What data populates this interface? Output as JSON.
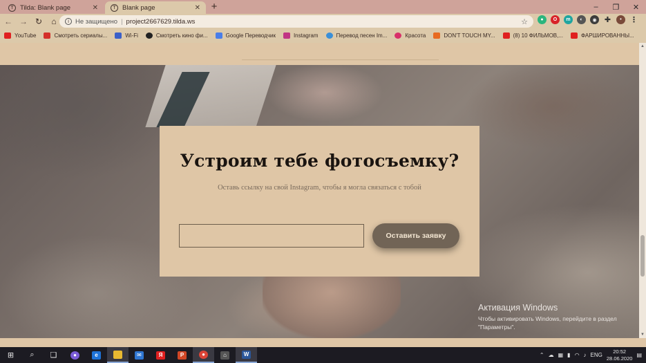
{
  "browser": {
    "tabs": [
      {
        "title": "Tilda: Blank page",
        "active": false
      },
      {
        "title": "Blank page",
        "active": true
      }
    ],
    "new_tab_symbol": "+",
    "window_controls": [
      "–",
      "❐",
      "✕"
    ],
    "nav": {
      "back": "←",
      "forward": "→",
      "reload": "↻",
      "home": "⌂"
    },
    "address": {
      "security_label": "Не защищено",
      "url": "project2667629.tilda.ws",
      "star": "☆"
    },
    "bookmarks": [
      {
        "label": "YouTube",
        "color": "#e02020"
      },
      {
        "label": "Смотреть сериалы...",
        "color": "#d4302a"
      },
      {
        "label": "Wi-Fi",
        "color": "#3a5fc8"
      },
      {
        "label": "Смотреть кино фи...",
        "color": "#222222"
      },
      {
        "label": "Google Переводчик",
        "color": "#4a7ee8"
      },
      {
        "label": "Instagram",
        "color": "#c13584"
      },
      {
        "label": "Перевод песен Im...",
        "color": "#3a8fd8"
      },
      {
        "label": "Красота",
        "color": "#d8306a"
      },
      {
        "label": "DON'T TOUCH MY...",
        "color": "#e86a20"
      },
      {
        "label": "(8) 10 ФИЛЬМОВ,...",
        "color": "#e02020"
      },
      {
        "label": "ФАРШИРОВАННЫ...",
        "color": "#e02020"
      }
    ]
  },
  "form": {
    "heading": "Устроим тебе фотосъемку?",
    "subtitle": "Оставь ссылку на свой Instagram, чтобы я могла связаться с тобой",
    "input_value": "",
    "submit_label": "Оставить заявку"
  },
  "activation": {
    "title": "Активация Windows",
    "text": "Чтобы активировать Windows, перейдите в раздел \"Параметры\"."
  },
  "taskbar": {
    "start": "⊞",
    "search": "⌕",
    "task_view": "❑",
    "tray": {
      "lang": "ENG",
      "time": "20:52",
      "date": "28.06.2020"
    }
  },
  "colors": {
    "accent": "#716456",
    "card_bg": "#dfc6a6",
    "tab_strip": "#cfa39a"
  }
}
